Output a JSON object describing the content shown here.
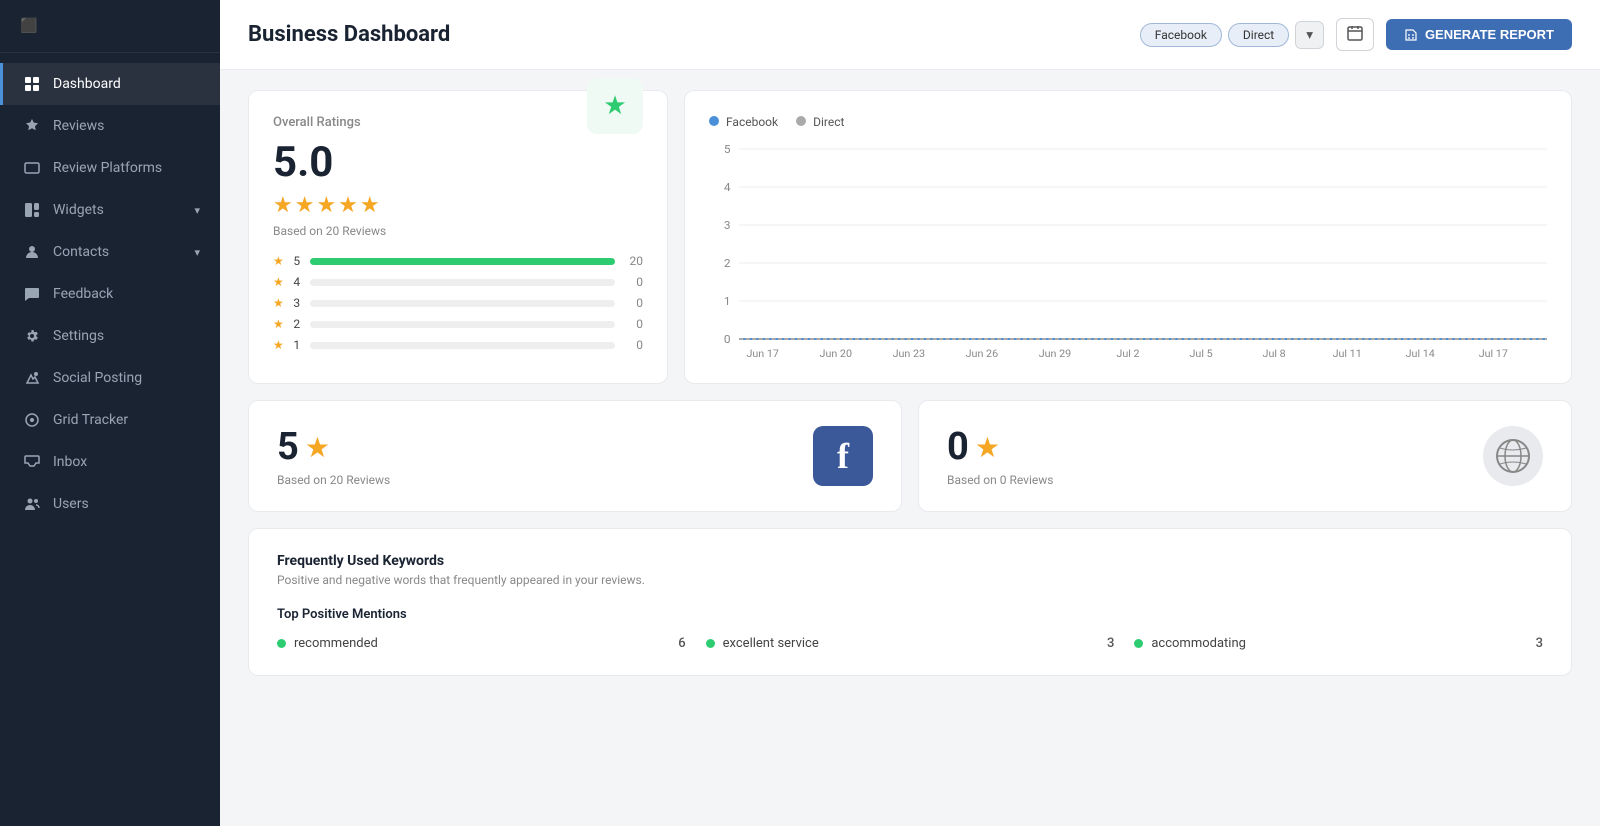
{
  "sidebar": {
    "items": [
      {
        "id": "dashboard",
        "label": "Dashboard",
        "icon": "⊞",
        "active": true
      },
      {
        "id": "reviews",
        "label": "Reviews",
        "icon": "★"
      },
      {
        "id": "review-platforms",
        "label": "Review Platforms",
        "icon": "⬡"
      },
      {
        "id": "widgets",
        "label": "Widgets",
        "icon": "◧",
        "hasChevron": true
      },
      {
        "id": "contacts",
        "label": "Contacts",
        "icon": "👤",
        "hasChevron": true
      },
      {
        "id": "feedback",
        "label": "Feedback",
        "icon": "💬"
      },
      {
        "id": "settings",
        "label": "Settings",
        "icon": "⚙"
      },
      {
        "id": "social-posting",
        "label": "Social Posting",
        "icon": "↗"
      },
      {
        "id": "grid-tracker",
        "label": "Grid Tracker",
        "icon": "⊙"
      },
      {
        "id": "inbox",
        "label": "Inbox",
        "icon": "✉"
      },
      {
        "id": "users",
        "label": "Users",
        "icon": "👥"
      }
    ]
  },
  "header": {
    "title": "Business Dashboard",
    "filters": [
      "Facebook",
      "Direct"
    ],
    "generate_btn": "GENERATE REPORT"
  },
  "overall_ratings": {
    "title": "Overall Ratings",
    "score": "5.0",
    "based_on": "Based on 20 Reviews",
    "bars": [
      {
        "stars": 5,
        "count": 20,
        "percent": 100
      },
      {
        "stars": 4,
        "count": 0,
        "percent": 0
      },
      {
        "stars": 3,
        "count": 0,
        "percent": 0
      },
      {
        "stars": 2,
        "count": 0,
        "percent": 0
      },
      {
        "stars": 1,
        "count": 0,
        "percent": 0
      }
    ]
  },
  "chart": {
    "legend": [
      "Facebook",
      "Direct"
    ],
    "y_labels": [
      5,
      4,
      3,
      2,
      1,
      0
    ],
    "x_labels": [
      "Jun 17",
      "Jun 20",
      "Jun 23",
      "Jun 26",
      "Jun 29",
      "Jul 2",
      "Jul 5",
      "Jul 8",
      "Jul 11",
      "Jul 14",
      "Jul 17"
    ]
  },
  "platform_facebook": {
    "score": "5",
    "based_on": "Based on 20 Reviews"
  },
  "platform_direct": {
    "score": "0",
    "based_on": "Based on 0 Reviews"
  },
  "keywords": {
    "title": "Frequently Used Keywords",
    "subtitle": "Positive and negative words that frequently appeared in your reviews.",
    "top_positive_title": "Top Positive Mentions",
    "mentions": [
      {
        "label": "recommended",
        "count": 6
      },
      {
        "label": "excellent service",
        "count": 3
      },
      {
        "label": "accommodating",
        "count": 3
      }
    ]
  }
}
